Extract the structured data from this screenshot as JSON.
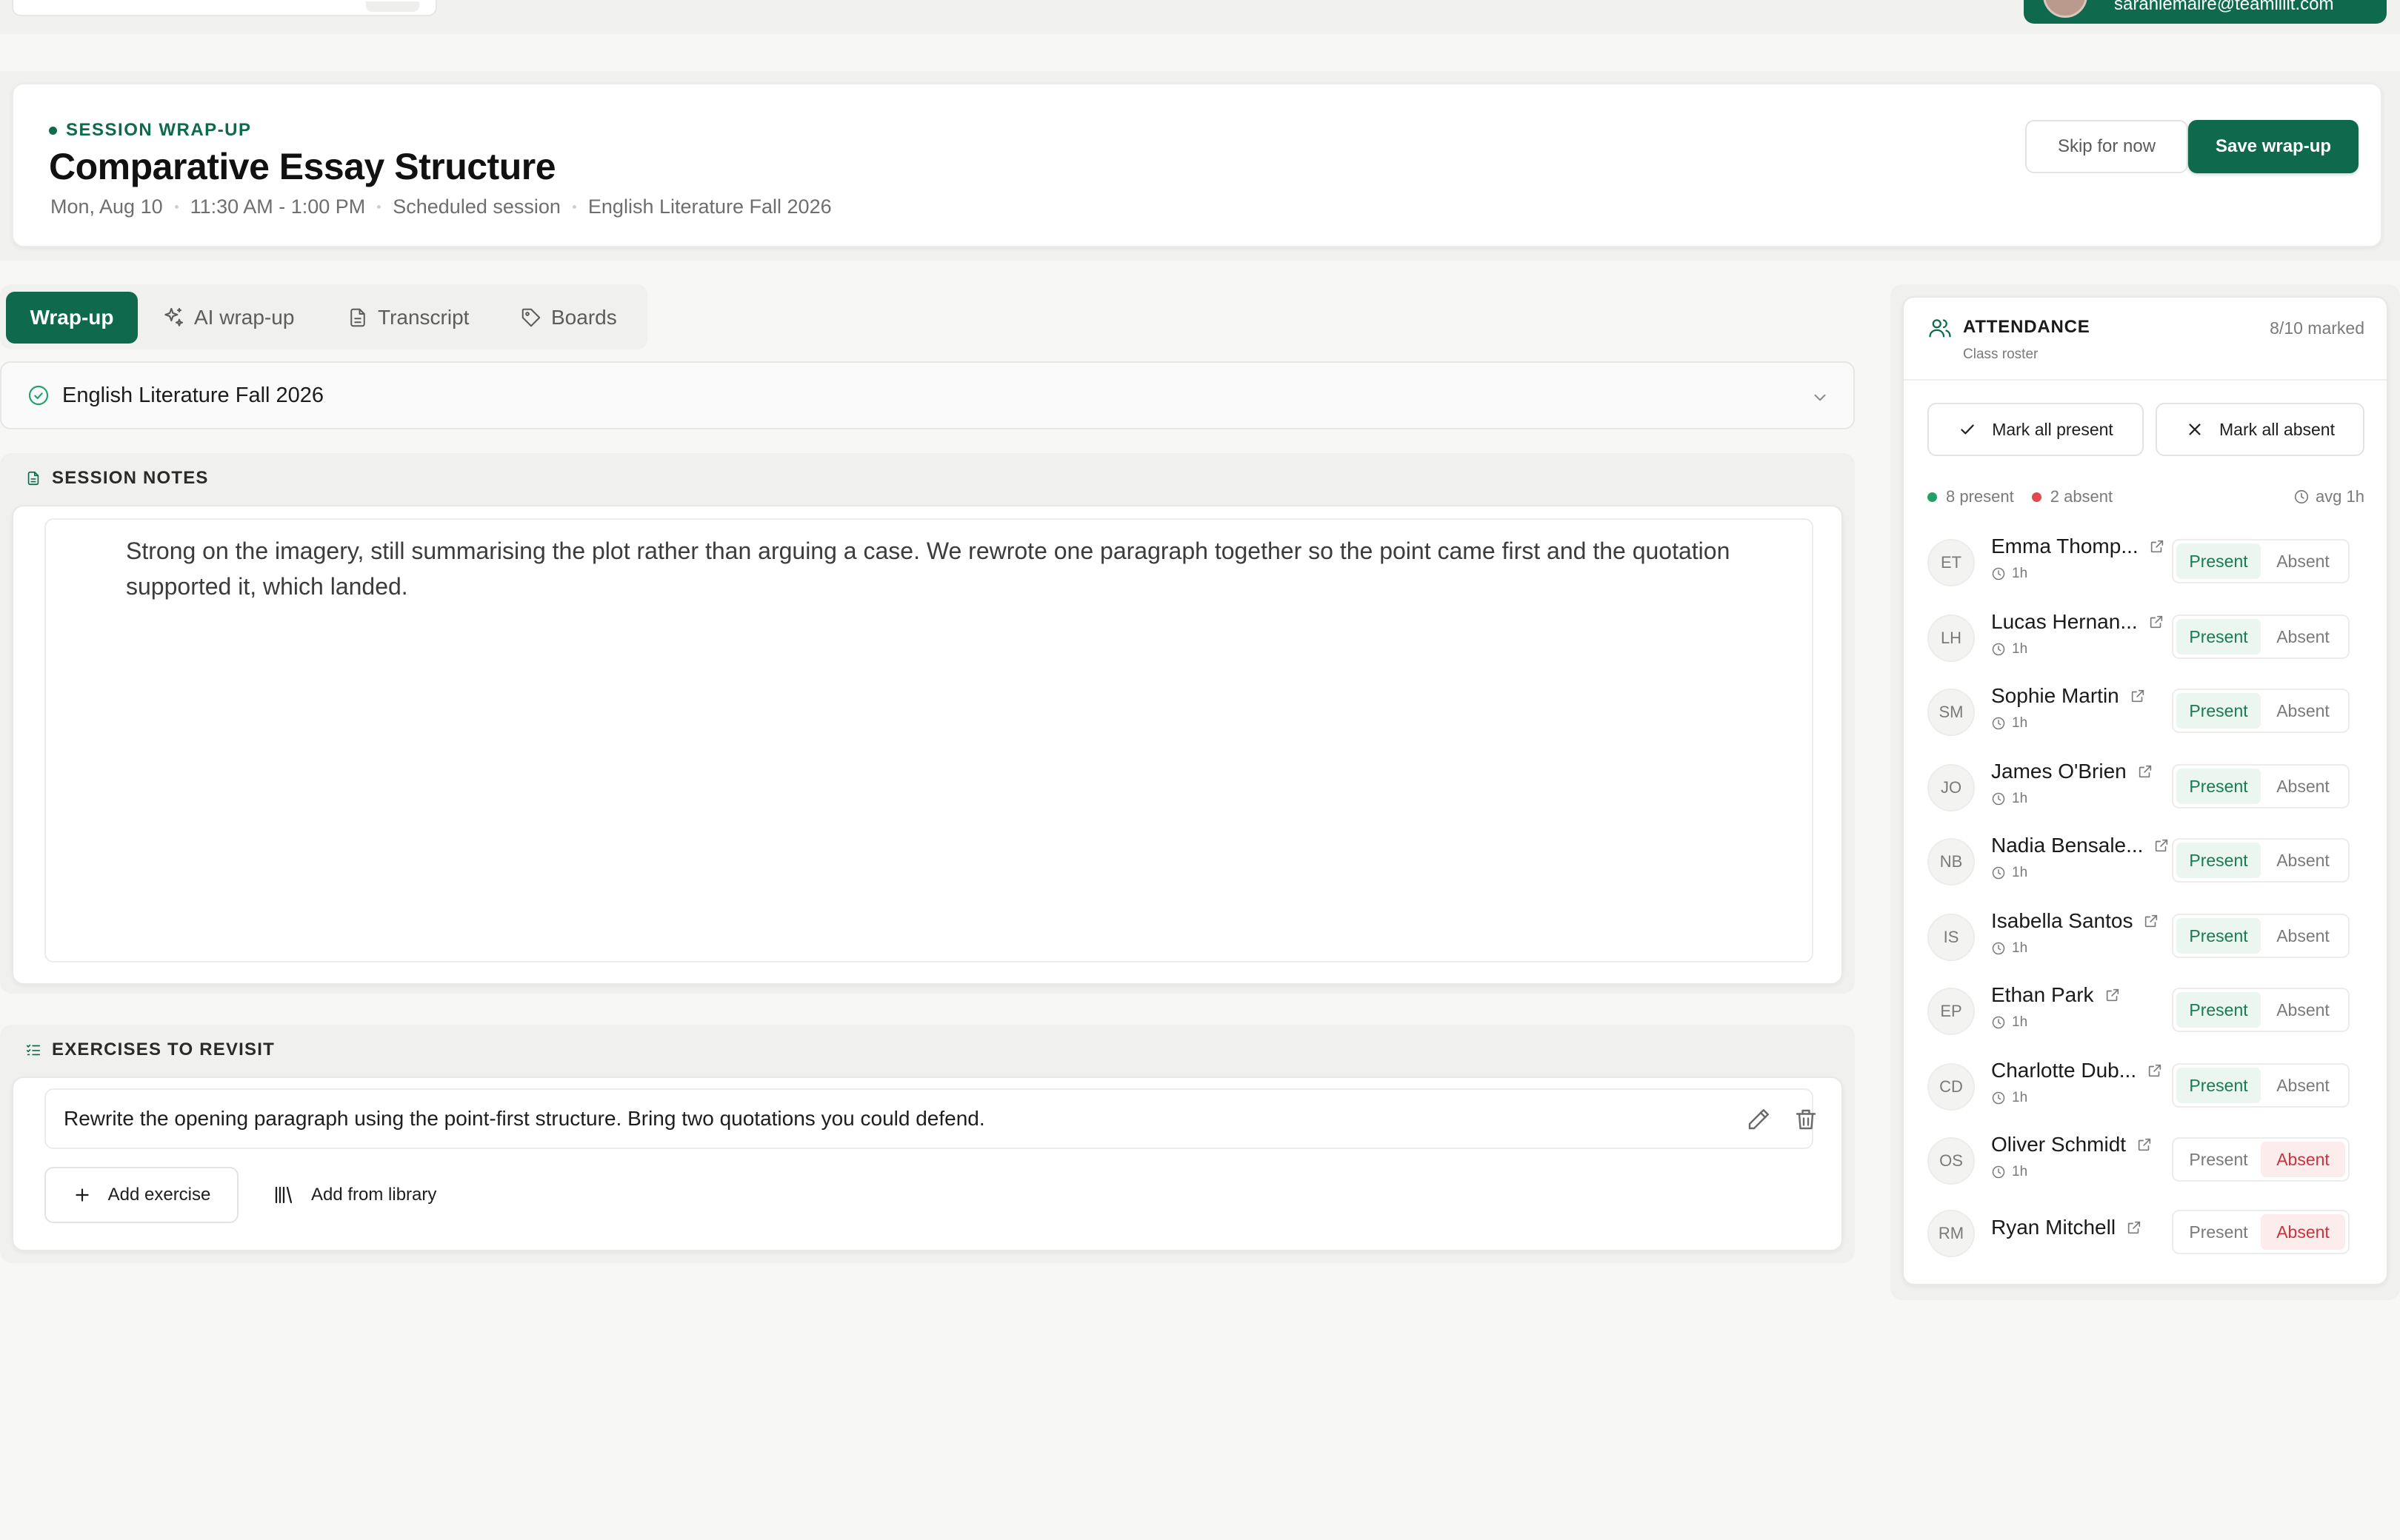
{
  "topbar": {
    "user_email": "sarahlemaire@teamlilit.com"
  },
  "header": {
    "eyebrow": "SESSION WRAP-UP",
    "title": "Comparative Essay Structure",
    "date": "Mon, Aug 10",
    "time": "11:30 AM - 1:00 PM",
    "session_type": "Scheduled session",
    "class_name": "English Literature Fall 2026",
    "skip_label": "Skip for now",
    "save_label": "Save wrap-up"
  },
  "tabs": [
    {
      "label": "Wrap-up",
      "icon": "none",
      "active": true
    },
    {
      "label": "AI wrap-up",
      "icon": "sparkles-icon",
      "active": false
    },
    {
      "label": "Transcript",
      "icon": "document-icon",
      "active": false
    },
    {
      "label": "Boards",
      "icon": "tag-icon",
      "active": false
    }
  ],
  "class_select": {
    "value": "English Literature Fall 2026"
  },
  "notes": {
    "heading": "SESSION NOTES",
    "text": "Strong on the imagery, still summarising the plot rather than arguing a case. We rewrote one paragraph together so the point came first and the quotation supported it, which landed."
  },
  "exercises": {
    "heading": "EXERCISES TO REVISIT",
    "items": [
      "Rewrite the opening paragraph using the point-first structure. Bring two quotations you could defend."
    ],
    "add_label": "Add exercise",
    "library_label": "Add from library"
  },
  "attendance": {
    "title": "ATTENDANCE",
    "subtitle": "Class roster",
    "marked": "8/10 marked",
    "mark_all_present": "Mark all present",
    "mark_all_absent": "Mark all absent",
    "present_count": "8 present",
    "absent_count": "2 absent",
    "avg": "avg 1h",
    "present_label": "Present",
    "absent_label": "Absent",
    "colors": {
      "present": "#22a06b",
      "absent": "#e5484d",
      "brand": "#0f6a4d"
    },
    "students": [
      {
        "initials": "ET",
        "name": "Emma Thomp...",
        "duration": "1h",
        "status": "present"
      },
      {
        "initials": "LH",
        "name": "Lucas Hernan...",
        "duration": "1h",
        "status": "present"
      },
      {
        "initials": "SM",
        "name": "Sophie Martin",
        "duration": "1h",
        "status": "present"
      },
      {
        "initials": "JO",
        "name": "James O'Brien",
        "duration": "1h",
        "status": "present"
      },
      {
        "initials": "NB",
        "name": "Nadia Bensale...",
        "duration": "1h",
        "status": "present"
      },
      {
        "initials": "IS",
        "name": "Isabella Santos",
        "duration": "1h",
        "status": "present"
      },
      {
        "initials": "EP",
        "name": "Ethan Park",
        "duration": "1h",
        "status": "present"
      },
      {
        "initials": "CD",
        "name": "Charlotte Dub...",
        "duration": "1h",
        "status": "present"
      },
      {
        "initials": "OS",
        "name": "Oliver Schmidt",
        "duration": "1h",
        "status": "absent"
      },
      {
        "initials": "RM",
        "name": "Ryan Mitchell",
        "duration": "",
        "status": "absent"
      }
    ]
  }
}
